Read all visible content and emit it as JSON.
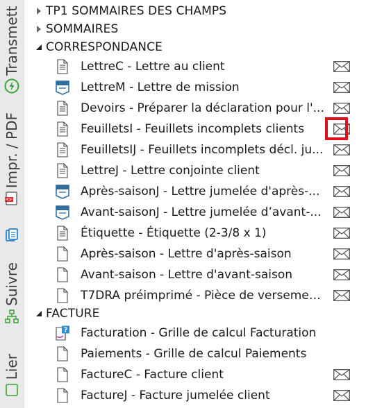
{
  "sidebar": {
    "transmettre_label": "Transmettre",
    "impr_pdf_label": "Impr. / PDF",
    "suivre_label": "Suivre",
    "lier_label": "Lier",
    "pdf_badge": "PDF"
  },
  "tree": {
    "groups": [
      {
        "label": "TP1 SOMMAIRES DES CHAMPS",
        "expanded": false
      },
      {
        "label": "SOMMAIRES",
        "expanded": false
      },
      {
        "label": "CORRESPONDANCE",
        "expanded": true
      },
      {
        "label": "FACTURE",
        "expanded": true
      }
    ],
    "correspondance_items": [
      {
        "label": "LettreC - Lettre au client",
        "icon": "document-icon",
        "has_mail": true
      },
      {
        "label": "LettreM - Lettre de mission",
        "icon": "letter-template-icon",
        "has_mail": true
      },
      {
        "label": "Devoirs - Préparer la déclaration pour l'...",
        "icon": "document-icon",
        "has_mail": true
      },
      {
        "label": "FeuilletsI - Feuillets incomplets clients",
        "icon": "document-icon",
        "has_mail": true
      },
      {
        "label": "FeuilletsIJ - Feuillets incomplets décl. ju...",
        "icon": "document-icon",
        "has_mail": true
      },
      {
        "label": "LettreJ - Lettre conjointe client",
        "icon": "document-icon",
        "has_mail": true
      },
      {
        "label": "Après-saisonJ - Lettre jumelée d'après-...",
        "icon": "letter-template-icon",
        "has_mail": true
      },
      {
        "label": "Avant-saisonJ - Lettre jumelée d’avant-...",
        "icon": "letter-template-icon",
        "has_mail": true
      },
      {
        "label": "Étiquette - Étiquette (2-3/8 x 1)",
        "icon": "document-icon",
        "has_mail": true
      },
      {
        "label": "Après-saison - Lettre d'après-saison",
        "icon": "blank-document-icon",
        "has_mail": true
      },
      {
        "label": "Avant-saison - Lettre d'avant-saison",
        "icon": "blank-document-icon",
        "has_mail": true
      },
      {
        "label": "T7DRA préimprimé - Pièce de versemen...",
        "icon": "blank-document-icon",
        "has_mail": true
      }
    ],
    "facture_items": [
      {
        "label": "Facturation - Grille de calcul Facturation",
        "icon": "calculation-grid-icon",
        "has_mail": false
      },
      {
        "label": "Paiements - Grille de calcul Paiements",
        "icon": "blank-document-icon",
        "has_mail": false
      },
      {
        "label": "FactureC - Facture client",
        "icon": "blank-document-icon",
        "has_mail": true
      },
      {
        "label": "FactureJ - Facture jumelée client",
        "icon": "blank-document-icon",
        "has_mail": true
      }
    ],
    "highlighted_item": "FeuilletsI - Feuillets incomplets clients"
  },
  "colors": {
    "sidebar_bg": "#e9e9e9",
    "accent_green": "#3aa13a",
    "accent_blue": "#2a7fc8",
    "highlight_red": "#e0101a",
    "template_icon_blue": "#2f6d9e"
  }
}
